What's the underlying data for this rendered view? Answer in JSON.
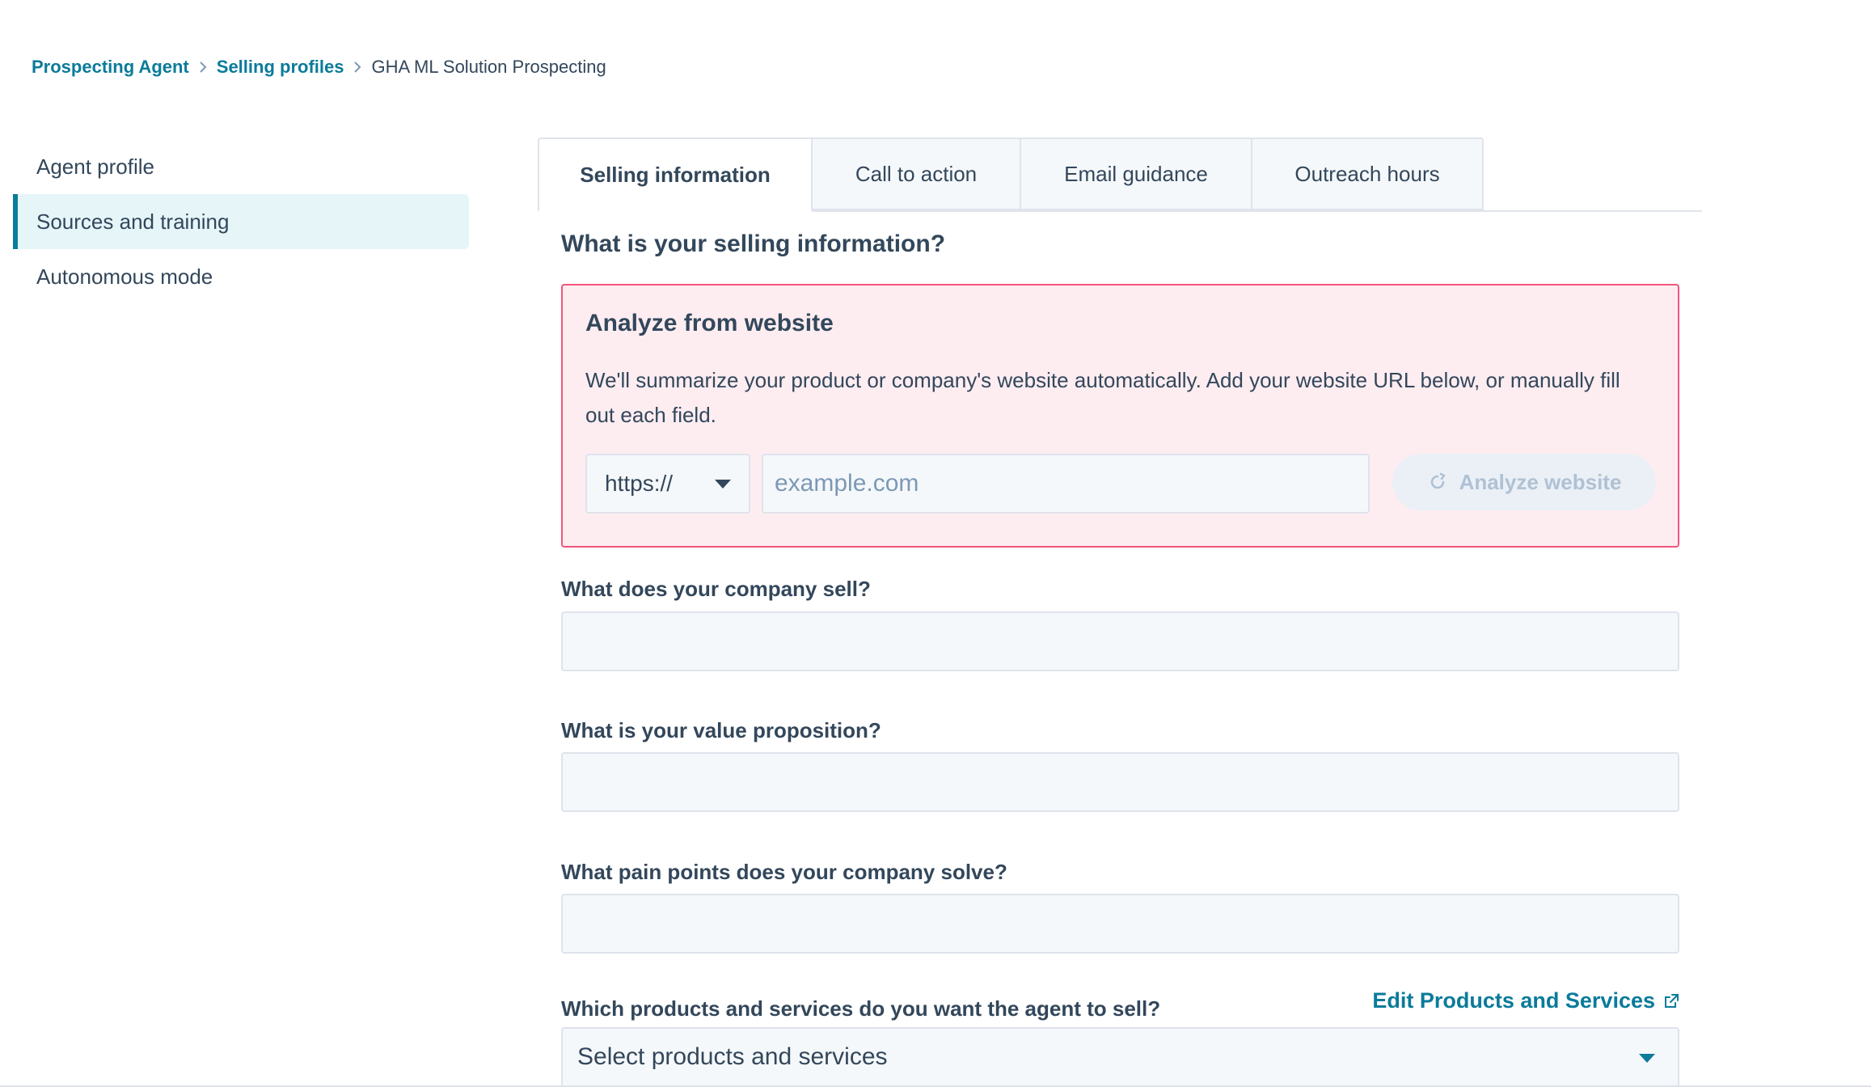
{
  "breadcrumb": {
    "items": [
      "Prospecting Agent",
      "Selling profiles"
    ],
    "current": "GHA ML Solution Prospecting"
  },
  "sidebar": {
    "items": [
      {
        "label": "Agent profile",
        "active": false
      },
      {
        "label": "Sources and training",
        "active": true
      },
      {
        "label": "Autonomous mode",
        "active": false
      }
    ]
  },
  "tabs": [
    {
      "label": "Selling information",
      "active": true
    },
    {
      "label": "Call to action",
      "active": false
    },
    {
      "label": "Email guidance",
      "active": false
    },
    {
      "label": "Outreach hours",
      "active": false
    }
  ],
  "main": {
    "title": "What is your selling information?",
    "analyze": {
      "title": "Analyze from website",
      "description": "We'll summarize your product or company's website automatically. Add your website URL below, or manually fill out each field.",
      "protocol": "https://",
      "url_placeholder": "example.com",
      "button_label": "Analyze website"
    },
    "fields": [
      {
        "label": "What does your company sell?",
        "value": ""
      },
      {
        "label": "What is your value proposition?",
        "value": ""
      },
      {
        "label": "What pain points does your company solve?",
        "value": ""
      }
    ],
    "products": {
      "label": "Which products and services do you want the agent to sell?",
      "edit_link": "Edit Products and Services",
      "placeholder": "Select products and services"
    }
  },
  "colors": {
    "accent": "#0b7b9a",
    "alert_bg": "#fdedf1",
    "alert_border": "#f2547d",
    "text": "#33475b"
  }
}
